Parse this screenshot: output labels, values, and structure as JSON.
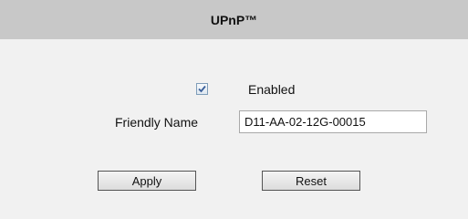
{
  "header": {
    "title": "UPnP™"
  },
  "form": {
    "enabled": {
      "checked": true,
      "label": "Enabled"
    },
    "friendly_name": {
      "label": "Friendly Name",
      "value": "D11-AA-02-12G-00015"
    }
  },
  "buttons": {
    "apply_label": "Apply",
    "reset_label": "Reset"
  },
  "icons": {
    "checkbox_check": "checkmark-icon"
  },
  "colors": {
    "header_bg": "#c8c8c8",
    "panel_bg": "#f1f1f1",
    "checkmark": "#3a5f9a"
  }
}
